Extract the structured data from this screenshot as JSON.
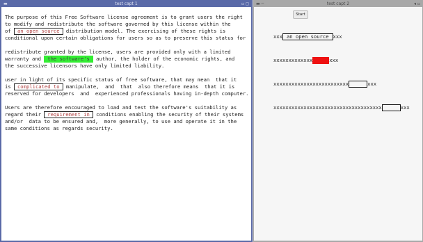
{
  "left_window": {
    "title": "test capt 1",
    "paragraphs": [
      {
        "lines": [
          {
            "pre": "The purpose of this Free Software license agreement is to grant users the right"
          },
          {
            "pre": "to modify and redistribute the software governed by this license within the"
          },
          {
            "pre": "of ",
            "hl": "an open source",
            "hl_style": "red",
            "post": " distribution model. The exercising of these rights is"
          },
          {
            "pre": "conditional upon certain obligations for users so as to preserve this status for"
          }
        ]
      },
      {
        "lines": [
          {
            "pre": "redistribute granted by the license, users are provided only with a limited"
          },
          {
            "pre": "warranty and ",
            "hl": "the software's",
            "hl_style": "green",
            "post": " author, the holder of the economic rights, and"
          },
          {
            "pre": "the successive licensors have only limited liability."
          }
        ]
      },
      {
        "lines": [
          {
            "pre": "user in light of its specific status of free software, that may mean  that it"
          },
          {
            "pre": "is ",
            "hl": "complicated to",
            "hl_style": "red",
            "post": " manipulate,  and  that  also therefore means  that it is"
          },
          {
            "pre": "reserved for developers  and  experienced professionals having in-depth computer."
          }
        ]
      },
      {
        "lines": [
          {
            "pre": "Users are therefore encouraged to load and test the software's suitability as"
          },
          {
            "pre": "regard their ",
            "hl": "requirement in",
            "hl_style": "red",
            "post": " conditions enabling the security of their systems"
          },
          {
            "pre": "and/or  data to be ensured and,  more generally, to use and operate it in the"
          },
          {
            "pre": "same conditions as regards security."
          }
        ]
      }
    ]
  },
  "right_window": {
    "title": "test capt 2",
    "start_label": "Start",
    "rows": [
      {
        "pre": "xxx",
        "box_text": "an open source",
        "box_style": "outlined",
        "post": "xxx"
      },
      {
        "pre": "xxxxxxxxxxxxx",
        "box_text": "",
        "box_style": "red",
        "post": "xxx"
      },
      {
        "pre": "xxxxxxxxxxxxxxxxxxxxxxxxx",
        "box_text": "",
        "box_style": "empty",
        "post": "xxx"
      },
      {
        "pre": "xxxxxxxxxxxxxxxxxxxxxxxxxxxxxxxxxxxx",
        "box_text": "",
        "box_style": "empty",
        "post": "xxx"
      }
    ]
  },
  "colors": {
    "left_frame": "#5a6aa8",
    "right_frame": "#a8a8a8",
    "highlight_red_text": "#b04040",
    "highlight_green": "#33ee33",
    "box_red": "#ee1111"
  }
}
